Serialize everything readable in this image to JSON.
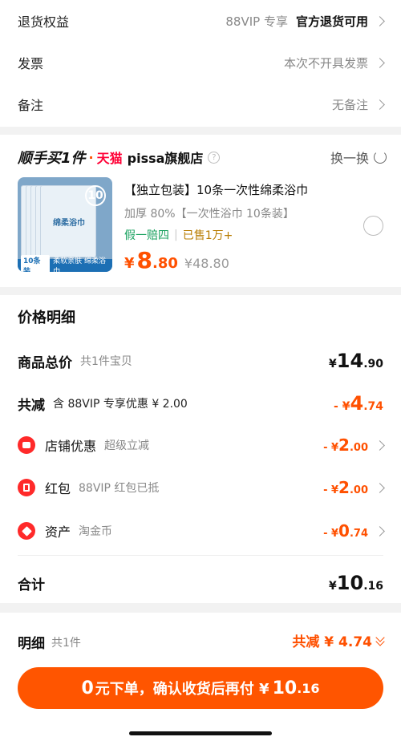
{
  "top_rows": [
    {
      "label": "退货权益",
      "value_gray": "88VIP 专享",
      "value_strong": "官方退货可用"
    },
    {
      "label": "发票",
      "value_gray": "本次不开具发票"
    },
    {
      "label": "备注",
      "value_gray": "无备注"
    }
  ],
  "store": {
    "brand": "顺手买1件",
    "dot": "·",
    "platform": "天猫",
    "shop_name": "pissa旗舰店",
    "help_icon": "question-icon",
    "swap_label": "换一换",
    "swap_icon": "refresh-icon"
  },
  "product": {
    "title": "【独立包装】10条一次性绵柔浴巾",
    "subtitle": "加厚 80%【一次性浴巾 10条装】",
    "tag_fake": "假一赔四",
    "tag_sep": "|",
    "tag_sold": "已售1万+",
    "price_currency": "¥",
    "price_int": "8",
    "price_dec": ".80",
    "price_orig": "¥48.80",
    "thumb_count": "10",
    "thumb_name": "绵柔浴巾",
    "thumb_badge": "10条装",
    "thumb_caption": "柔软亲肤 绵柔浴巾"
  },
  "price_detail": {
    "title": "价格明细",
    "goods": {
      "label": "商品总价",
      "sub": "共1件宝贝",
      "currency": "¥",
      "int": "14",
      "dec": ".90"
    },
    "discount": {
      "label": "共减",
      "sub": "含 88VIP 专享优惠 ¥ 2.00",
      "currency": "- ¥",
      "int": "4",
      "dec": ".74"
    },
    "items": [
      {
        "label": "店铺优惠",
        "sub": "超级立减",
        "currency": "- ¥",
        "int": "2",
        "dec": ".00",
        "icon": "shop-icon"
      },
      {
        "label": "红包",
        "sub": "88VIP 红包已抵",
        "currency": "- ¥",
        "int": "2",
        "dec": ".00",
        "icon": "red-packet-icon"
      },
      {
        "label": "资产",
        "sub": "淘金币",
        "currency": "- ¥",
        "int": "0",
        "dec": ".74",
        "icon": "coin-tag-icon"
      }
    ],
    "total": {
      "label": "合计",
      "currency": "¥",
      "int": "10",
      "dec": ".16"
    }
  },
  "footer": {
    "detail_label": "明细",
    "detail_count": "共1件",
    "saving": "共减 ¥ 4.74",
    "cta_zero": "0",
    "cta_text": "元下单，确认收货后再付 ¥",
    "cta_int": "10",
    "cta_dec": ".16"
  },
  "colors": {
    "accent": "#ff5000",
    "tmall": "#ff0036",
    "green": "#19a15f"
  }
}
